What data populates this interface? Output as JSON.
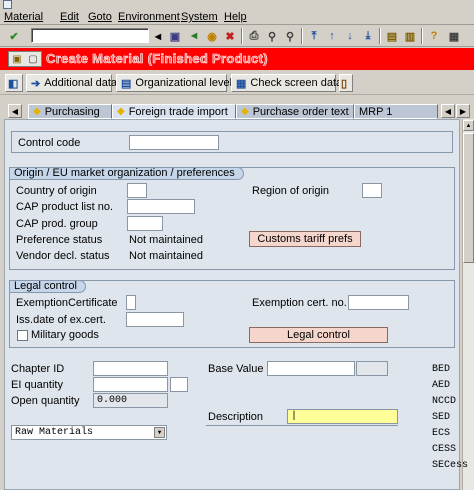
{
  "menubar": {
    "items": [
      "Material",
      "Edit",
      "Goto",
      "Environment",
      "System",
      "Help"
    ]
  },
  "title": "Create Material  (Finished Product)",
  "app_toolbar": {
    "additional_data": "Additional data",
    "org_levels": "Organizational levels",
    "check_screen": "Check screen data"
  },
  "tabs": [
    "Purchasing",
    "Foreign trade import",
    "Purchase order text",
    "MRP 1"
  ],
  "active_tab": "Foreign trade import",
  "control": {
    "control_code_label": "Control code",
    "control_code_value": ""
  },
  "origin": {
    "title": "Origin / EU market organization / preferences",
    "country_label": "Country of origin",
    "region_label": "Region of origin",
    "cap_list_label": "CAP product list no.",
    "cap_group_label": "CAP prod. group",
    "pref_status_label": "Preference status",
    "pref_status_value": "Not maintained",
    "vendor_decl_label": "Vendor decl. status",
    "vendor_decl_value": "Not maintained",
    "customs_button": "Customs tariff prefs"
  },
  "legal": {
    "title": "Legal control",
    "exemption_cert_label": "ExemptionCertificate",
    "exemption_no_label": "Exemption cert. no.",
    "iss_date_label": "Iss.date of ex.cert.",
    "military_label": "Military goods",
    "legal_button": "Legal control"
  },
  "excise": {
    "chapter_label": "Chapter ID",
    "ei_qty_label": "EI quantity",
    "open_qty_label": "Open quantity",
    "open_qty_value": "0.000",
    "base_value_label": "Base Value",
    "description_label": "Description",
    "material_type_value": "Raw Materials",
    "side_labels": [
      "BED",
      "AED",
      "NCCD",
      "SED",
      "ECS",
      "CESS",
      "SECess"
    ]
  },
  "colors": {
    "title_bar": "#ff0000",
    "panel_bg": "#dfe5ec",
    "group_header": "#c6d6ea",
    "button_bg": "#f5d6cc",
    "required_field": "#ffff99"
  },
  "icons": [
    "app-icon",
    "check-icon",
    "save-icon",
    "back-icon",
    "exit-icon",
    "cancel-icon",
    "print-icon",
    "find-icon",
    "find-next-icon",
    "first-page-icon",
    "prev-page-icon",
    "next-page-icon",
    "last-page-icon",
    "new-session-icon",
    "shortcut-icon",
    "help-icon",
    "layout-icon"
  ]
}
